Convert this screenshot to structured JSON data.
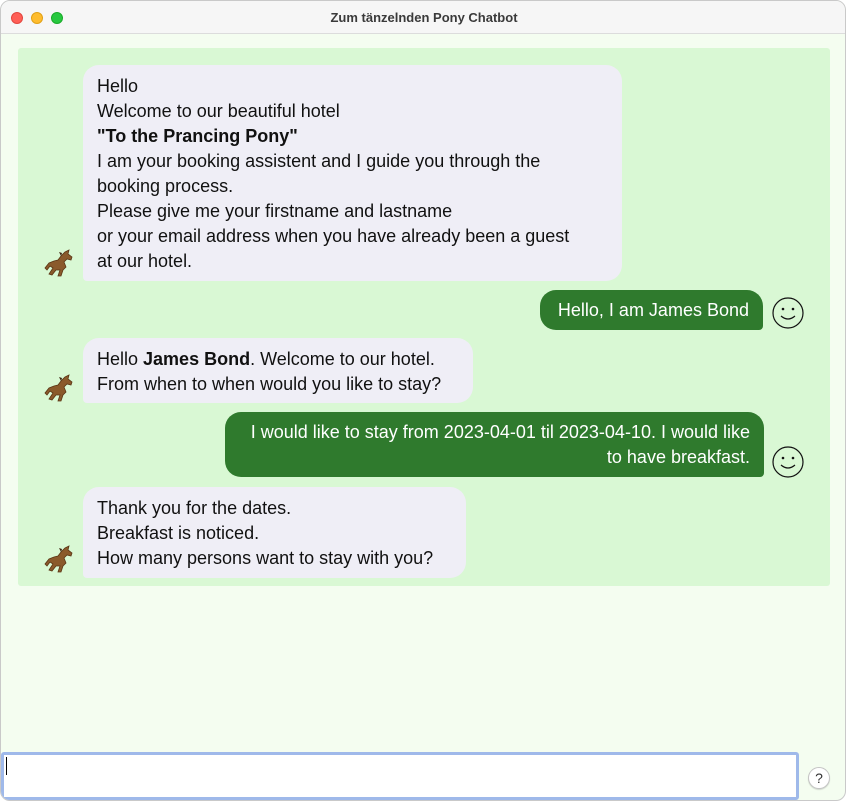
{
  "window": {
    "title": "Zum tänzelnden Pony Chatbot"
  },
  "messages": [
    {
      "sender": "bot",
      "lines": [
        "Hello",
        "Welcome to our beautiful hotel",
        "\"To the Prancing Pony\"",
        "I am your booking assistent and I guide you through the",
        "booking process.",
        "Please give me your firstname and lastname",
        "or your email address when you have already been a guest",
        "at our hotel."
      ]
    },
    {
      "sender": "user",
      "text": "Hello, I am James Bond"
    },
    {
      "sender": "bot",
      "greeting": "Hello ",
      "name": "James Bond",
      "greeting_rest": ". Welcome to our hotel.",
      "line2": "From when to when would you like to stay?"
    },
    {
      "sender": "user",
      "text": "I would like to stay from 2023-04-01 til 2023-04-10. I would like to have breakfast."
    },
    {
      "sender": "bot",
      "lines": [
        "Thank you for the dates.",
        "Breakfast is noticed.",
        "How many persons want to stay with you?"
      ]
    }
  ],
  "input": {
    "value": "",
    "placeholder": ""
  },
  "help_button": {
    "label": "?"
  },
  "icons": {
    "bot_avatar": "horse-icon",
    "user_avatar": "smiley-icon"
  },
  "colors": {
    "chat_background": "#d9f8d4",
    "bot_bubble": "#efeef6",
    "user_bubble": "#2f7a2d",
    "input_focus": "#9fb9ea"
  }
}
